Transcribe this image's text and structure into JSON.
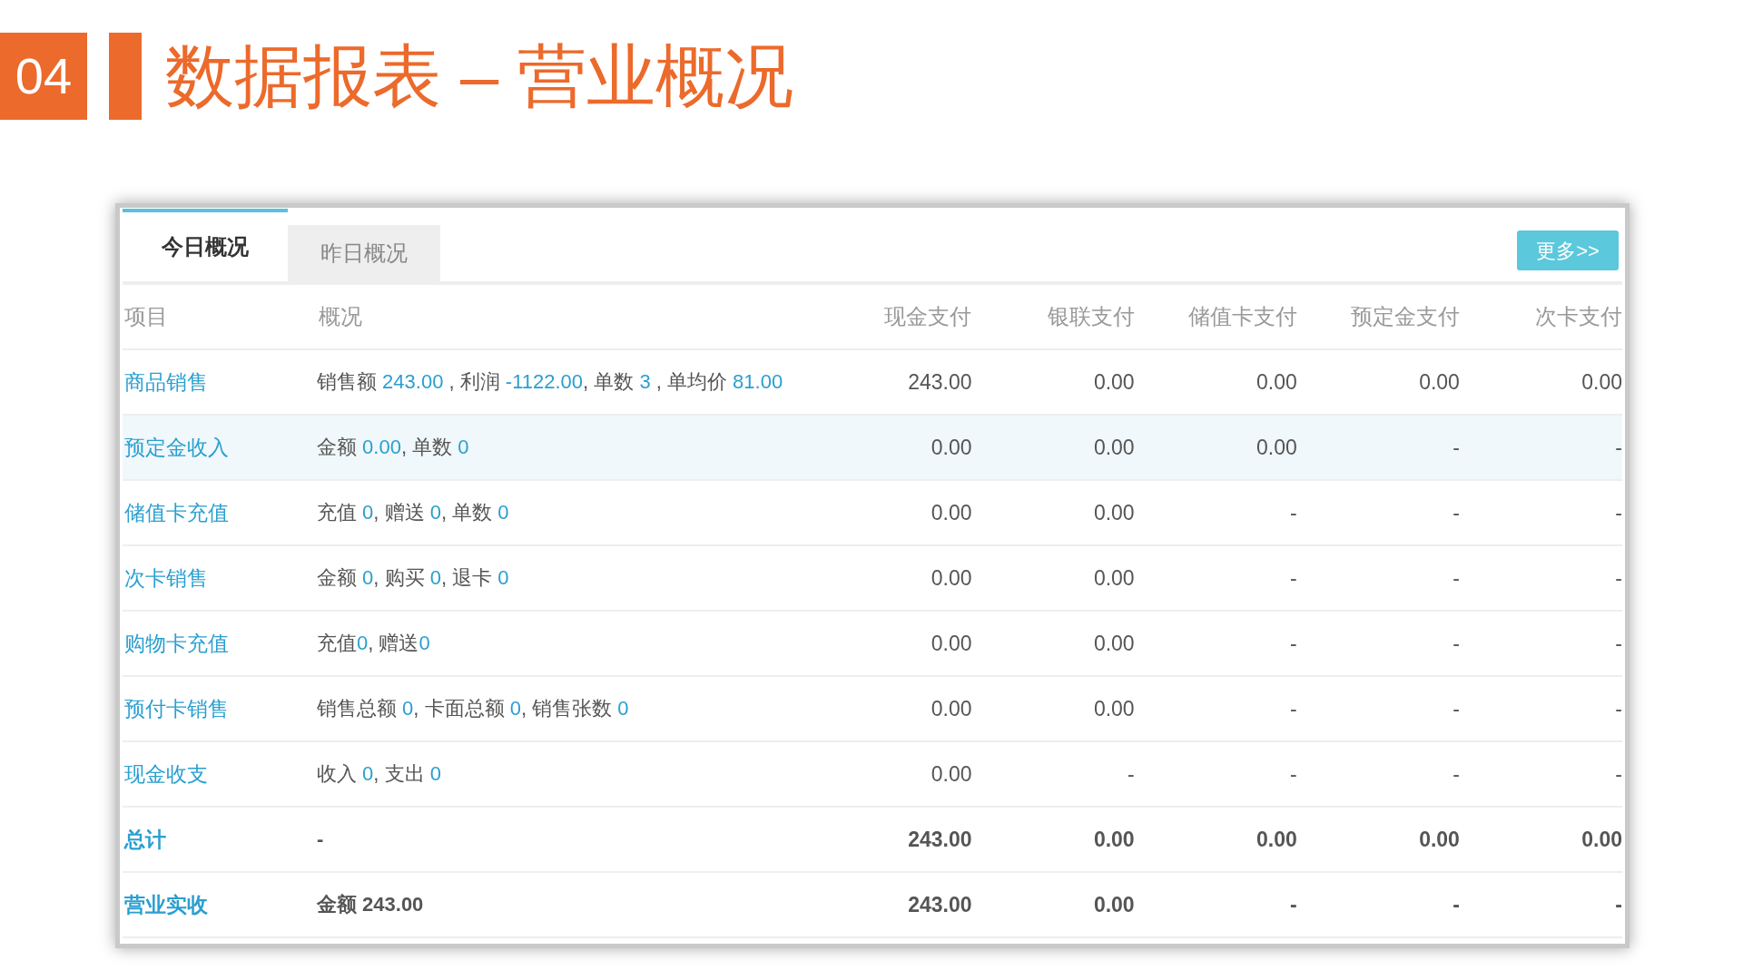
{
  "slide": {
    "number": "04",
    "title": "数据报表 – 营业概况"
  },
  "tabs": [
    {
      "label": "今日概况",
      "selected": true
    },
    {
      "label": "昨日概况",
      "selected": false
    }
  ],
  "more_button": "更多>>",
  "table": {
    "columns": [
      "项目",
      "概况",
      "现金支付",
      "银联支付",
      "储值卡支付",
      "预定金支付",
      "次卡支付"
    ],
    "rows": [
      {
        "kind": "item",
        "highlighted": false,
        "name": "商品销售",
        "summary": [
          {
            "kind": "label",
            "text": "销售额 "
          },
          {
            "kind": "value",
            "text": "243.00"
          },
          {
            "kind": "label",
            "text": " , 利润 "
          },
          {
            "kind": "value",
            "text": "-1122.00"
          },
          {
            "kind": "label",
            "text": ", 单数 "
          },
          {
            "kind": "value",
            "text": "3"
          },
          {
            "kind": "label",
            "text": " , 单均价 "
          },
          {
            "kind": "value",
            "text": "81.00"
          }
        ],
        "amounts": [
          "243.00",
          "0.00",
          "0.00",
          "0.00",
          "0.00"
        ]
      },
      {
        "kind": "item",
        "highlighted": true,
        "name": "预定金收入",
        "summary": [
          {
            "kind": "label",
            "text": "金额 "
          },
          {
            "kind": "value",
            "text": "0.00"
          },
          {
            "kind": "label",
            "text": ", 单数 "
          },
          {
            "kind": "value",
            "text": "0"
          }
        ],
        "amounts": [
          "0.00",
          "0.00",
          "0.00",
          "-",
          "-"
        ]
      },
      {
        "kind": "item",
        "highlighted": false,
        "name": "储值卡充值",
        "summary": [
          {
            "kind": "label",
            "text": "充值 "
          },
          {
            "kind": "value",
            "text": "0"
          },
          {
            "kind": "label",
            "text": ", 赠送 "
          },
          {
            "kind": "value",
            "text": "0"
          },
          {
            "kind": "label",
            "text": ", 单数 "
          },
          {
            "kind": "value",
            "text": "0"
          }
        ],
        "amounts": [
          "0.00",
          "0.00",
          "-",
          "-",
          "-"
        ]
      },
      {
        "kind": "item",
        "highlighted": false,
        "name": "次卡销售",
        "summary": [
          {
            "kind": "label",
            "text": "金额 "
          },
          {
            "kind": "value",
            "text": "0"
          },
          {
            "kind": "label",
            "text": ", 购买 "
          },
          {
            "kind": "value",
            "text": "0"
          },
          {
            "kind": "label",
            "text": ", 退卡 "
          },
          {
            "kind": "value",
            "text": "0"
          }
        ],
        "amounts": [
          "0.00",
          "0.00",
          "-",
          "-",
          "-"
        ]
      },
      {
        "kind": "item",
        "highlighted": false,
        "name": "购物卡充值",
        "summary": [
          {
            "kind": "label",
            "text": "充值"
          },
          {
            "kind": "value",
            "text": "0"
          },
          {
            "kind": "label",
            "text": ", 赠送"
          },
          {
            "kind": "value",
            "text": "0"
          }
        ],
        "amounts": [
          "0.00",
          "0.00",
          "-",
          "-",
          "-"
        ]
      },
      {
        "kind": "item",
        "highlighted": false,
        "name": "预付卡销售",
        "summary": [
          {
            "kind": "label",
            "text": "销售总额 "
          },
          {
            "kind": "value",
            "text": "0"
          },
          {
            "kind": "label",
            "text": ", 卡面总额 "
          },
          {
            "kind": "value",
            "text": "0"
          },
          {
            "kind": "label",
            "text": ", 销售张数 "
          },
          {
            "kind": "value",
            "text": "0"
          }
        ],
        "amounts": [
          "0.00",
          "0.00",
          "-",
          "-",
          "-"
        ]
      },
      {
        "kind": "item",
        "highlighted": false,
        "name": "现金收支",
        "summary": [
          {
            "kind": "label",
            "text": "收入 "
          },
          {
            "kind": "value",
            "text": "0"
          },
          {
            "kind": "label",
            "text": ", 支出 "
          },
          {
            "kind": "value",
            "text": "0"
          }
        ],
        "amounts": [
          "0.00",
          "-",
          "-",
          "-",
          "-"
        ]
      },
      {
        "kind": "total",
        "highlighted": false,
        "name": "总计",
        "summary": [
          {
            "kind": "label",
            "text": "-"
          }
        ],
        "amounts": [
          "243.00",
          "0.00",
          "0.00",
          "0.00",
          "0.00"
        ]
      },
      {
        "kind": "total",
        "highlighted": false,
        "name": "营业实收",
        "summary": [
          {
            "kind": "label",
            "text": "金额 243.00"
          }
        ],
        "amounts": [
          "243.00",
          "0.00",
          "-",
          "-",
          "-"
        ]
      }
    ]
  }
}
